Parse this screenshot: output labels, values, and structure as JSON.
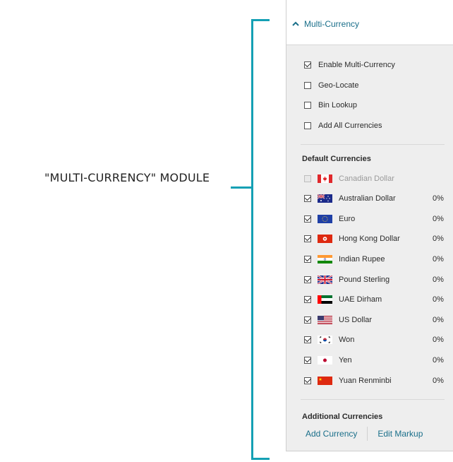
{
  "annotation": {
    "label": "\"MULTI-CURRENCY\" MODULE",
    "accent_color": "#14a0b4"
  },
  "panel": {
    "title": "Multi-Currency",
    "options": [
      {
        "label": "Enable Multi-Currency",
        "checked": true
      },
      {
        "label": "Geo-Locate",
        "checked": false
      },
      {
        "label": "Bin Lookup",
        "checked": false
      },
      {
        "label": "Add All Currencies",
        "checked": false
      }
    ],
    "default_currencies_title": "Default Currencies",
    "currencies": [
      {
        "name": "Canadian Dollar",
        "checked": false,
        "disabled": true,
        "pct": "",
        "flag": "canada-flag-icon"
      },
      {
        "name": "Australian Dollar",
        "checked": true,
        "disabled": false,
        "pct": "0%",
        "flag": "australia-flag-icon"
      },
      {
        "name": "Euro",
        "checked": true,
        "disabled": false,
        "pct": "0%",
        "flag": "eu-flag-icon"
      },
      {
        "name": "Hong Kong Dollar",
        "checked": true,
        "disabled": false,
        "pct": "0%",
        "flag": "hong-kong-flag-icon"
      },
      {
        "name": "Indian Rupee",
        "checked": true,
        "disabled": false,
        "pct": "0%",
        "flag": "india-flag-icon"
      },
      {
        "name": "Pound Sterling",
        "checked": true,
        "disabled": false,
        "pct": "0%",
        "flag": "uk-flag-icon"
      },
      {
        "name": "UAE Dirham",
        "checked": true,
        "disabled": false,
        "pct": "0%",
        "flag": "uae-flag-icon"
      },
      {
        "name": "US Dollar",
        "checked": true,
        "disabled": false,
        "pct": "0%",
        "flag": "us-flag-icon"
      },
      {
        "name": "Won",
        "checked": true,
        "disabled": false,
        "pct": "0%",
        "flag": "korea-flag-icon"
      },
      {
        "name": "Yen",
        "checked": true,
        "disabled": false,
        "pct": "0%",
        "flag": "japan-flag-icon"
      },
      {
        "name": "Yuan Renminbi",
        "checked": true,
        "disabled": false,
        "pct": "0%",
        "flag": "china-flag-icon"
      }
    ],
    "additional_currencies_title": "Additional Currencies",
    "add_currency_label": "Add Currency",
    "edit_markup_label": "Edit Markup",
    "link_color": "#1a6f8a"
  }
}
